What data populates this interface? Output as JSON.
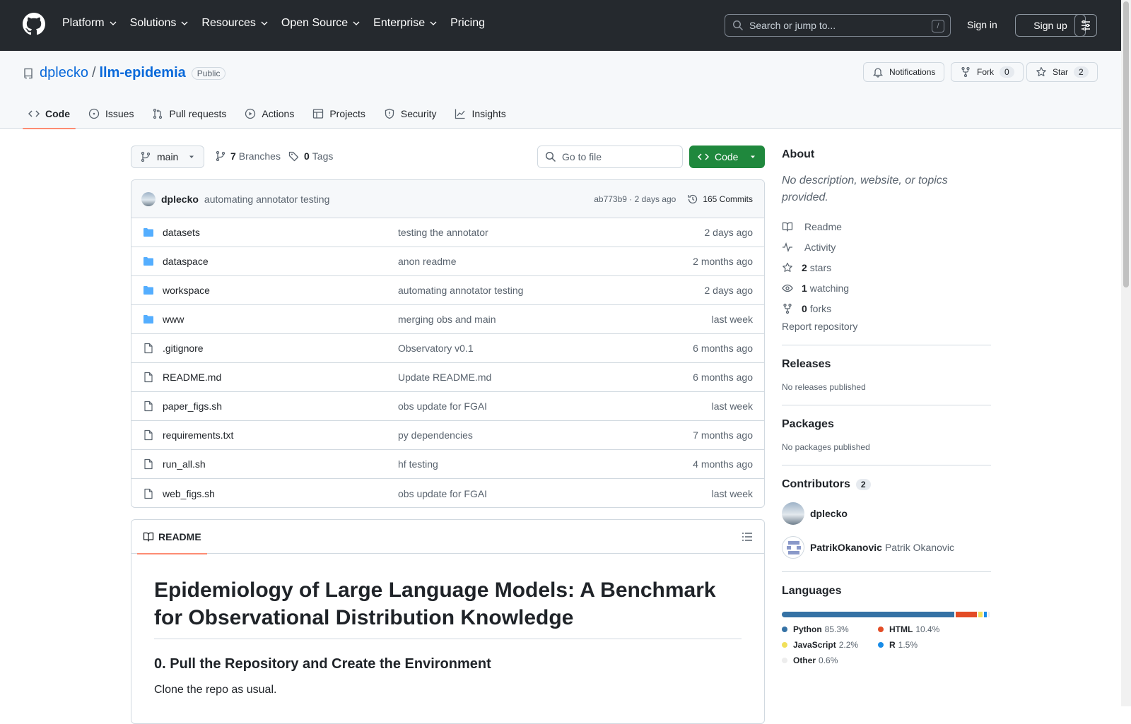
{
  "header": {
    "nav": [
      "Platform",
      "Solutions",
      "Resources",
      "Open Source",
      "Enterprise",
      "Pricing"
    ],
    "search_placeholder": "Search or jump to...",
    "slash_key": "/",
    "sign_in": "Sign in",
    "sign_up": "Sign up"
  },
  "repo": {
    "owner": "dplecko",
    "separator": "/",
    "name": "llm-epidemia",
    "visibility": "Public",
    "notifications": "Notifications",
    "fork_label": "Fork",
    "fork_count": "0",
    "star_label": "Star",
    "star_count": "2",
    "tabs": [
      "Code",
      "Issues",
      "Pull requests",
      "Actions",
      "Projects",
      "Security",
      "Insights"
    ]
  },
  "toolbar": {
    "branch": "main",
    "branches_count": "7",
    "branches_label": "Branches",
    "tags_count": "0",
    "tags_label": "Tags",
    "goto_placeholder": "Go to file",
    "code_button": "Code"
  },
  "commit": {
    "author": "dplecko",
    "message": "automating annotator testing",
    "hash_time": "ab773b9 · 2 days ago",
    "commits": "165 Commits"
  },
  "files": [
    {
      "name": "datasets",
      "type": "dir",
      "message": "testing the annotator",
      "date": "2 days ago"
    },
    {
      "name": "dataspace",
      "type": "dir",
      "message": "anon readme",
      "date": "2 months ago"
    },
    {
      "name": "workspace",
      "type": "dir",
      "message": "automating annotator testing",
      "date": "2 days ago"
    },
    {
      "name": "www",
      "type": "dir",
      "message": "merging obs and main",
      "date": "last week"
    },
    {
      "name": ".gitignore",
      "type": "file",
      "message": "Observatory v0.1",
      "date": "6 months ago"
    },
    {
      "name": "README.md",
      "type": "file",
      "message": "Update README.md",
      "date": "6 months ago"
    },
    {
      "name": "paper_figs.sh",
      "type": "file",
      "message": "obs update for FGAI",
      "date": "last week"
    },
    {
      "name": "requirements.txt",
      "type": "file",
      "message": "py dependencies",
      "date": "7 months ago"
    },
    {
      "name": "run_all.sh",
      "type": "file",
      "message": "hf testing",
      "date": "4 months ago"
    },
    {
      "name": "web_figs.sh",
      "type": "file",
      "message": "obs update for FGAI",
      "date": "last week"
    }
  ],
  "readme": {
    "tab": "README",
    "h1": "Epidemiology of Large Language Models: A Benchmark for Observational Distribution Knowledge",
    "h2": "0. Pull the Repository and Create the Environment",
    "p": "Clone the repo as usual."
  },
  "sidebar": {
    "about_title": "About",
    "about_desc": "No description, website, or topics provided.",
    "links": [
      {
        "icon": "book-icon",
        "bold": "",
        "label": "Readme"
      },
      {
        "icon": "pulse-icon",
        "bold": "",
        "label": "Activity"
      },
      {
        "icon": "star-icon",
        "bold": "2",
        "label": "stars"
      },
      {
        "icon": "eye-icon",
        "bold": "1",
        "label": "watching"
      },
      {
        "icon": "fork-icon",
        "bold": "0",
        "label": "forks"
      }
    ],
    "report": "Report repository",
    "releases_title": "Releases",
    "releases_sub": "No releases published",
    "packages_title": "Packages",
    "packages_sub": "No packages published",
    "contributors_title": "Contributors",
    "contributors_count": "2",
    "contributors": [
      {
        "login": "dplecko",
        "name": ""
      },
      {
        "login": "PatrikOkanovic",
        "name": "Patrik Okanovic"
      }
    ],
    "languages_title": "Languages",
    "languages": [
      {
        "name": "Python",
        "pct": "85.3%",
        "value": 85.3,
        "color": "#3572A5"
      },
      {
        "name": "HTML",
        "pct": "10.4%",
        "value": 10.4,
        "color": "#e34c26"
      },
      {
        "name": "JavaScript",
        "pct": "2.2%",
        "value": 2.2,
        "color": "#f1e05a"
      },
      {
        "name": "R",
        "pct": "1.5%",
        "value": 1.5,
        "color": "#198CE7"
      },
      {
        "name": "Other",
        "pct": "0.6%",
        "value": 0.6,
        "color": "#ededed"
      }
    ]
  },
  "colors": {
    "header_bg": "#25292e",
    "link": "#0969da",
    "primary_button": "#1f883d",
    "active_tab_underline": "#fd8c73",
    "folder": "#54aeff"
  }
}
